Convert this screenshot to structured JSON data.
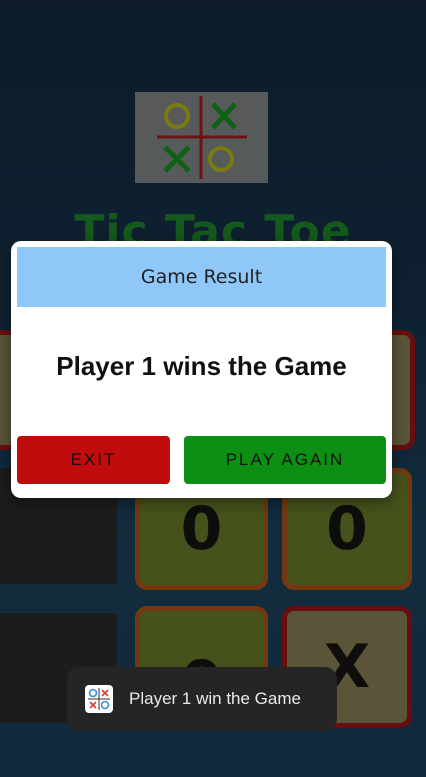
{
  "app": {
    "title": "Tic Tac Toe"
  },
  "board": {
    "cells": [
      {
        "id": "r1c1",
        "mark": ""
      },
      {
        "id": "r1c2",
        "mark": "0"
      },
      {
        "id": "r1c3",
        "mark": "0"
      },
      {
        "id": "r2c1",
        "mark": ""
      },
      {
        "id": "r2c2",
        "mark": "0"
      },
      {
        "id": "r2c3",
        "mark": "X"
      }
    ]
  },
  "dialog": {
    "title": "Game Result",
    "message": "Player 1 wins the Game",
    "exit_label": "EXIT",
    "play_again_label": "PLAY AGAIN"
  },
  "toast": {
    "icon": "tic-tac-toe-icon",
    "message": "Player 1 win the Game"
  },
  "colors": {
    "dialog_header": "#8fc7f8",
    "exit_button": "#c00c0c",
    "play_again_button": "#0c8f12",
    "title": "#1f8a2c"
  }
}
